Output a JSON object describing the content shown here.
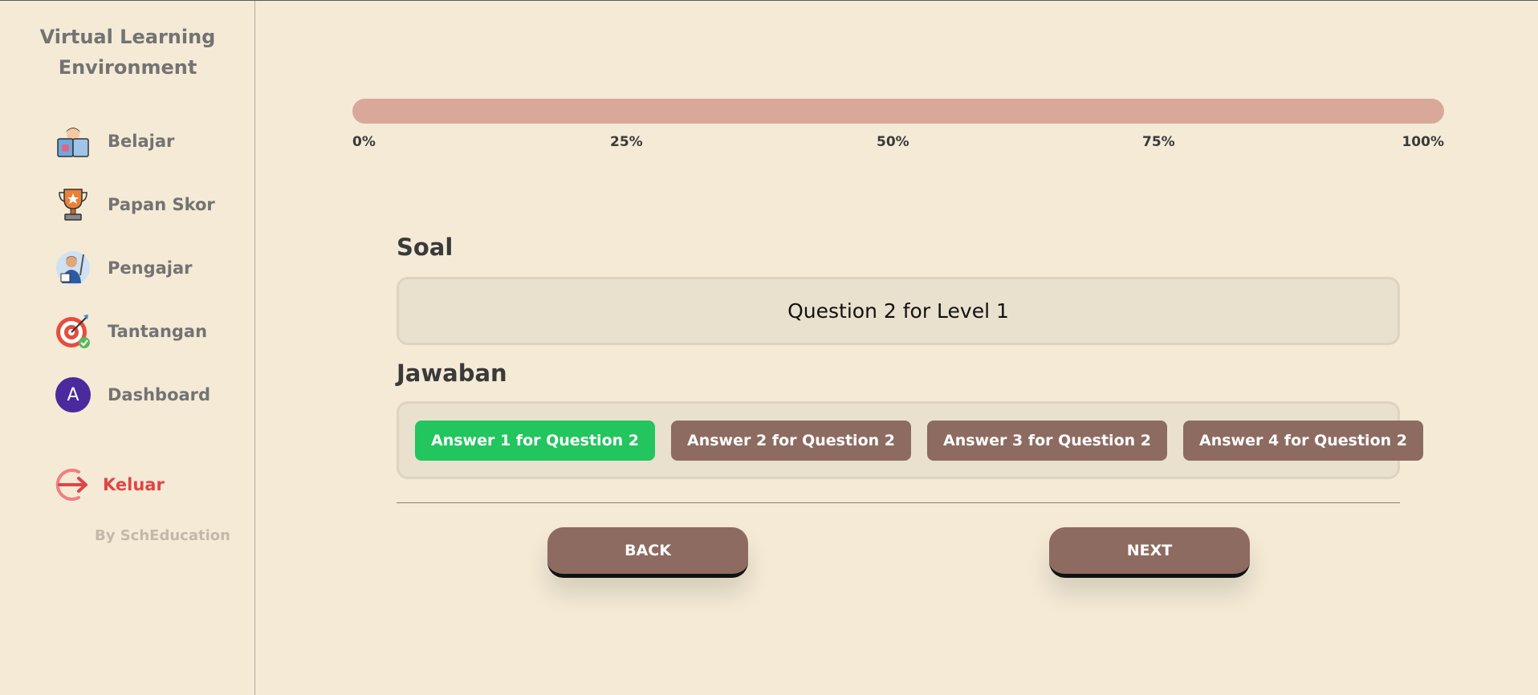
{
  "brand": {
    "line1": "Virtual Learning",
    "line2": "Environment"
  },
  "sidebar": {
    "items": [
      {
        "label": "Belajar",
        "icon": "reading-student-icon"
      },
      {
        "label": "Papan Skor",
        "icon": "trophy-icon"
      },
      {
        "label": "Pengajar",
        "icon": "teacher-icon"
      },
      {
        "label": "Tantangan",
        "icon": "target-icon"
      },
      {
        "label": "Dashboard",
        "icon": "avatar-icon",
        "avatar_letter": "A"
      }
    ],
    "logout_label": "Keluar",
    "byline": "By SchEducation"
  },
  "progress": {
    "value_percent": 0,
    "labels": [
      "0%",
      "25%",
      "50%",
      "75%",
      "100%"
    ]
  },
  "quiz": {
    "question_heading": "Soal",
    "question_text": "Question 2 for Level 1",
    "answer_heading": "Jawaban",
    "answers": [
      "Answer 1 for Question 2",
      "Answer 2 for Question 2",
      "Answer 3 for Question 2",
      "Answer 4 for Question 2"
    ],
    "selected_index": 0,
    "back_label": "BACK",
    "next_label": "NEXT"
  },
  "colors": {
    "background": "#f4ead6",
    "accent_brown": "#8d6b61",
    "progress_track": "#d9a89a",
    "selected_green": "#22c55e",
    "logout_red": "#e04545"
  }
}
